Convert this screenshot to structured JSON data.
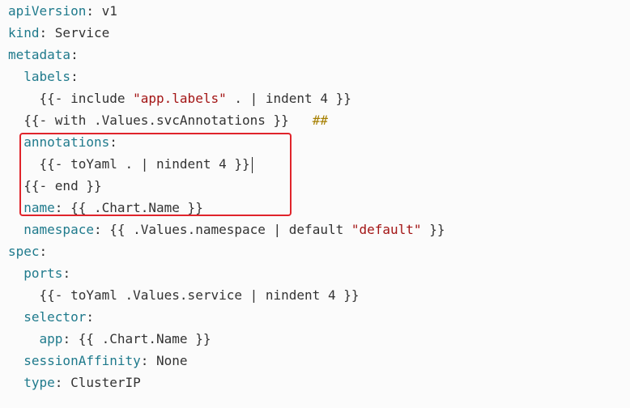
{
  "lines": [
    {
      "indent": "",
      "key": "apiVersion",
      "sep": ": ",
      "val": "v1"
    },
    {
      "indent": "",
      "key": "kind",
      "sep": ": ",
      "val": "Service"
    },
    {
      "indent": "",
      "key": "metadata",
      "sep": ":"
    },
    {
      "indent": "  ",
      "key": "labels",
      "sep": ":"
    },
    {
      "indent": "    ",
      "pre": "{{- include ",
      "str": "\"app.labels\"",
      "post": " . | indent 4 }}"
    },
    {
      "indent": "  ",
      "pre": "{{- with .Values.svcAnnotations }}   ",
      "cmt": "##"
    },
    {
      "indent": "  ",
      "key": "annotations",
      "sep": ":"
    },
    {
      "indent": "    ",
      "pre": "{{- toYaml . | nindent 4 }}"
    },
    {
      "indent": "  ",
      "pre": "{{- end }}"
    },
    {
      "indent": "  ",
      "key": "name",
      "sep": ": ",
      "val": "{{ .Chart.Name }}"
    },
    {
      "indent": "  ",
      "key": "namespace",
      "sep": ": ",
      "pre": "{{ .Values.namespace | default ",
      "str": "\"default\"",
      "post": " }}"
    },
    {
      "indent": "",
      "key": "spec",
      "sep": ":"
    },
    {
      "indent": "  ",
      "key": "ports",
      "sep": ":"
    },
    {
      "indent": "    ",
      "pre": "{{- toYaml .Values.service | nindent 4 }}"
    },
    {
      "indent": "  ",
      "key": "selector",
      "sep": ":"
    },
    {
      "indent": "    ",
      "key": "app",
      "sep": ": ",
      "val": "{{ .Chart.Name }}"
    },
    {
      "indent": "  ",
      "key": "sessionAffinity",
      "sep": ": ",
      "val": "None"
    },
    {
      "indent": "  ",
      "key": "type",
      "sep": ": ",
      "val": "ClusterIP"
    }
  ],
  "colors": {
    "key": "#1f7a8c",
    "string": "#a31515",
    "comment": "#a67f00",
    "highlight_border": "#e0242b"
  }
}
